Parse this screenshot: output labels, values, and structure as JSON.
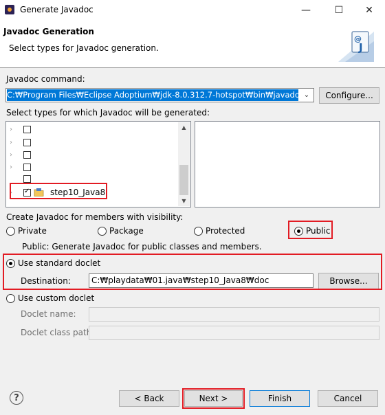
{
  "window": {
    "title": "Generate Javadoc",
    "controls": [
      "—",
      "☐",
      "✕"
    ]
  },
  "header": {
    "title": "Javadoc Generation",
    "subtitle": "Select types for Javadoc generation.",
    "icon": "javadoc-wizard-icon"
  },
  "javadoc_command": {
    "label": "Javadoc command:",
    "value": "C:₩Program Files₩Eclipse Adoptium₩jdk-8.0.312.7-hotspot₩bin₩javadoc.exe",
    "configure_label": "Configure..."
  },
  "types": {
    "label": "Select types for which Javadoc will be generated:",
    "tree_items": [
      {
        "label": "",
        "checked": false
      },
      {
        "label": "",
        "checked": false
      },
      {
        "label": "",
        "checked": false
      },
      {
        "label": "",
        "checked": false
      },
      {
        "label": "",
        "checked": false
      },
      {
        "label": "step10_Java8",
        "checked": true
      }
    ]
  },
  "visibility": {
    "label": "Create Javadoc for members with visibility:",
    "options": [
      "Private",
      "Package",
      "Protected",
      "Public"
    ],
    "selected": "Public",
    "description": "Public: Generate Javadoc for public classes and members."
  },
  "standard_doclet": {
    "label": "Use standard doclet",
    "selected": true,
    "destination_label": "Destination:",
    "destination_value": "C:₩playdata₩01.java₩step10_Java8₩doc",
    "browse_label": "Browse..."
  },
  "custom_doclet": {
    "label": "Use custom doclet",
    "selected": false,
    "name_label": "Doclet name:",
    "class_path_label": "Doclet class path:"
  },
  "buttons": {
    "back": "< Back",
    "next": "Next >",
    "finish": "Finish",
    "cancel": "Cancel"
  },
  "colors": {
    "highlight": "#e21b23",
    "selection": "#0078d7",
    "default_button_border": "#0078d7"
  }
}
